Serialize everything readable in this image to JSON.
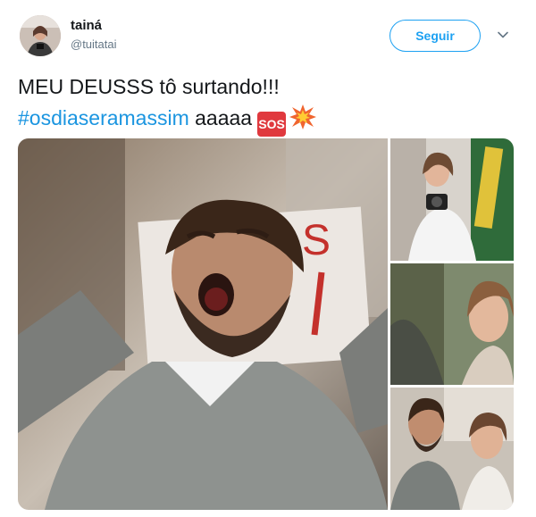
{
  "user": {
    "display_name": "tainá",
    "handle": "@tuitatai"
  },
  "actions": {
    "follow_label": "Seguir"
  },
  "icons": {
    "menu": "chevron-down-icon",
    "emoji_1": "sos-button-emoji",
    "emoji_2": "collision-emoji"
  },
  "tweet": {
    "line1": "MEU DEUSSS tô surtando!!!",
    "hashtag": "#osdiaseramassim",
    "rest": " aaaaa",
    "sos": "SOS"
  },
  "media": {
    "count": 4
  },
  "colors": {
    "accent": "#1da1f2",
    "hashtag": "#1b95e0",
    "handle": "#657786",
    "sos": "#e0393e"
  }
}
